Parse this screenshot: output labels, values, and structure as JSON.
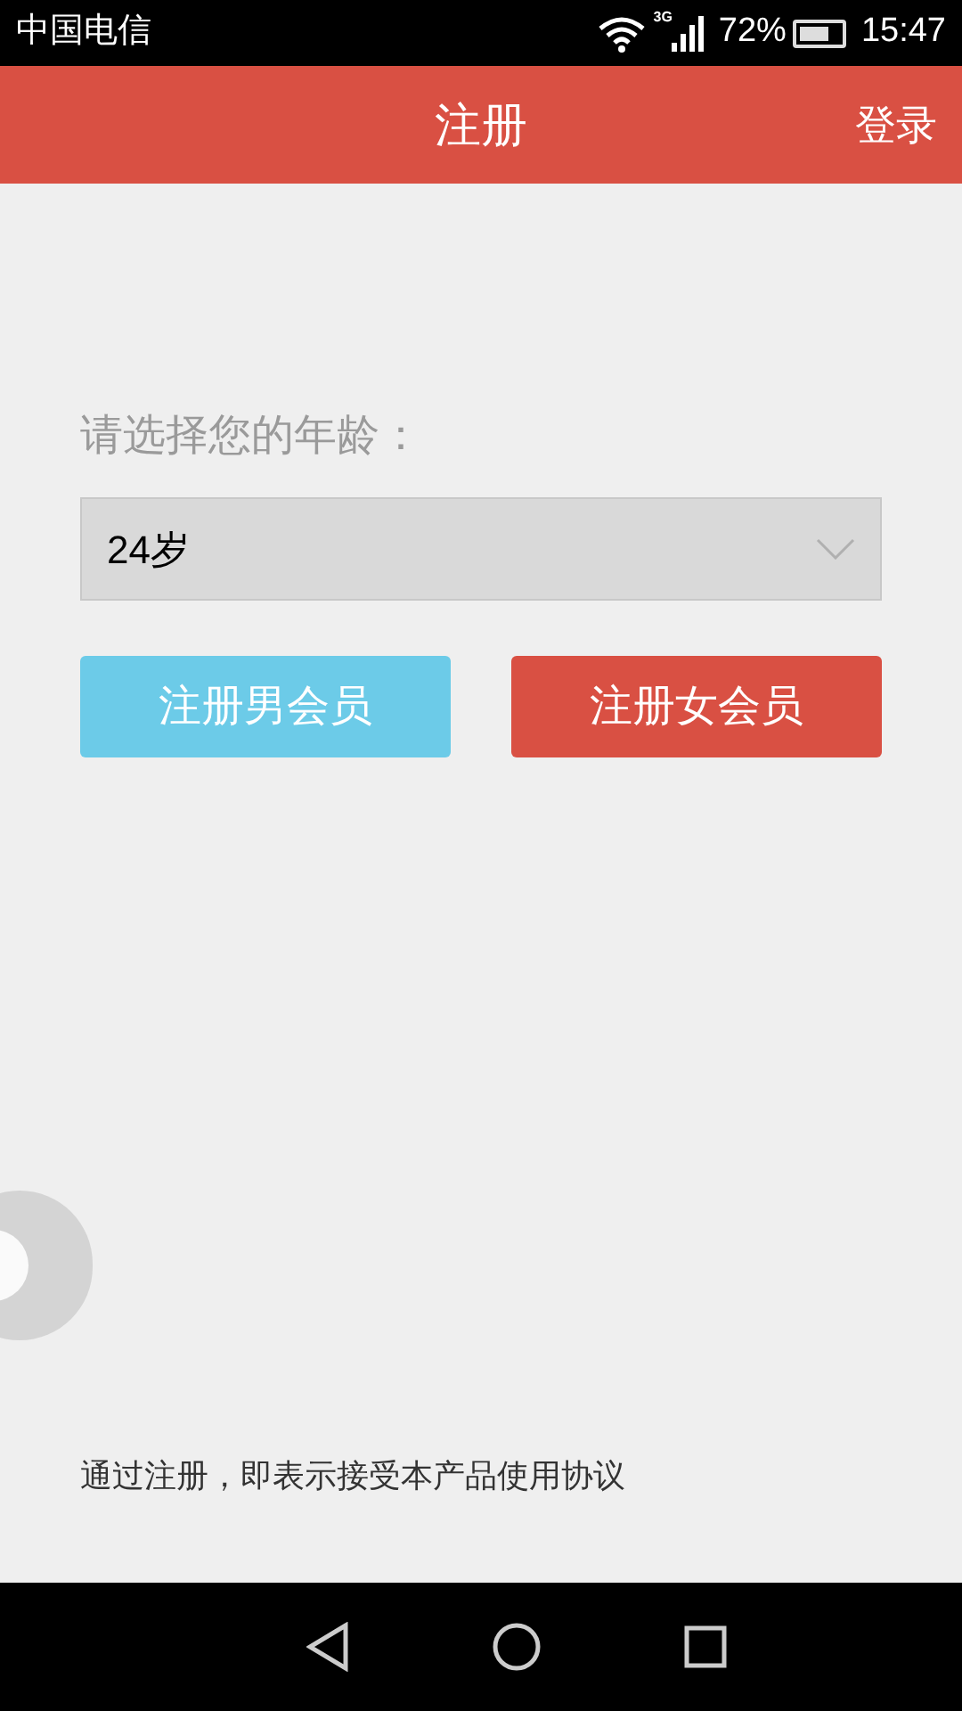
{
  "status_bar": {
    "carrier": "中国电信",
    "network": "3G",
    "battery_text": "72%",
    "time": "15:47"
  },
  "header": {
    "title": "注册",
    "action": "登录"
  },
  "age": {
    "label": "请选择您的年龄：",
    "value": "24岁"
  },
  "buttons": [
    {
      "label": "注册男会员",
      "kind": "male"
    },
    {
      "label": "注册女会员",
      "kind": "female"
    }
  ],
  "agreement": "通过注册，即表示接受本产品使用协议"
}
